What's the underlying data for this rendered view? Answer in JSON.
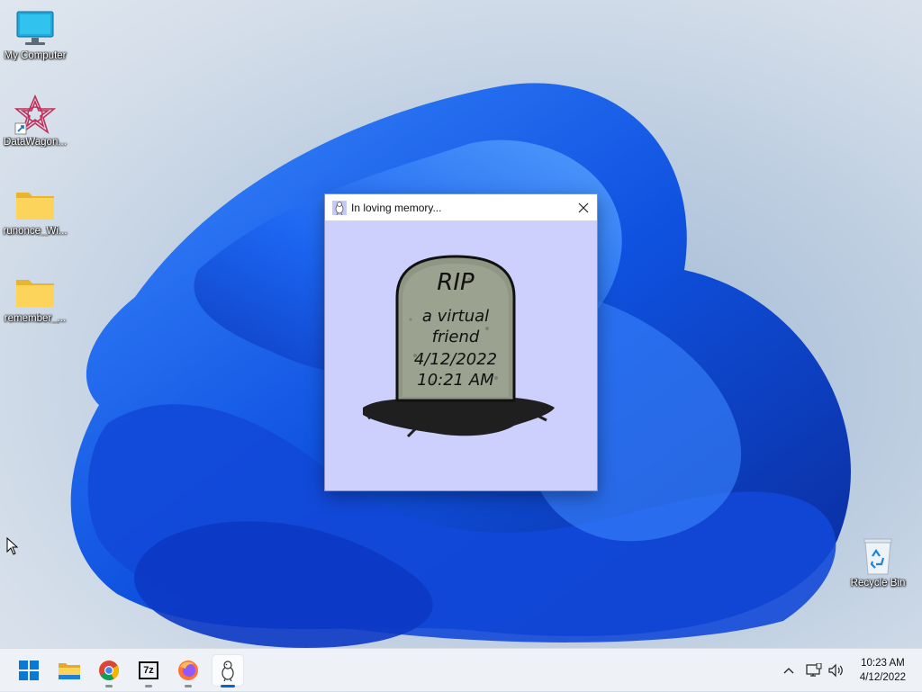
{
  "desktop": {
    "icons": [
      {
        "label": "My Computer",
        "icon": "monitor-icon"
      },
      {
        "label": "DataWagon...",
        "icon": "datawagon-icon"
      },
      {
        "label": "runonce_Wi...",
        "icon": "folder-icon"
      },
      {
        "label": "remember_...",
        "icon": "folder-icon"
      },
      {
        "label": "Recycle Bin",
        "icon": "recycle-bin-icon"
      }
    ]
  },
  "window": {
    "title": "In loving memory...",
    "tombstone": {
      "line1": "RIP",
      "line2": "a virtual",
      "line3": "friend",
      "line4": "4/12/2022",
      "line5": "10:21 AM"
    },
    "background_color": "#cdd0fd"
  },
  "taskbar": {
    "apps": [
      "start-icon",
      "file-explorer-icon",
      "chrome-icon",
      "7zip-icon",
      "firefox-icon",
      "pet-app-icon"
    ],
    "sevenzip_text": "7z",
    "active_app": "pet-app-icon",
    "accent": "#0a64c8"
  },
  "clock": {
    "time": "10:23 AM",
    "date": "4/12/2022"
  }
}
